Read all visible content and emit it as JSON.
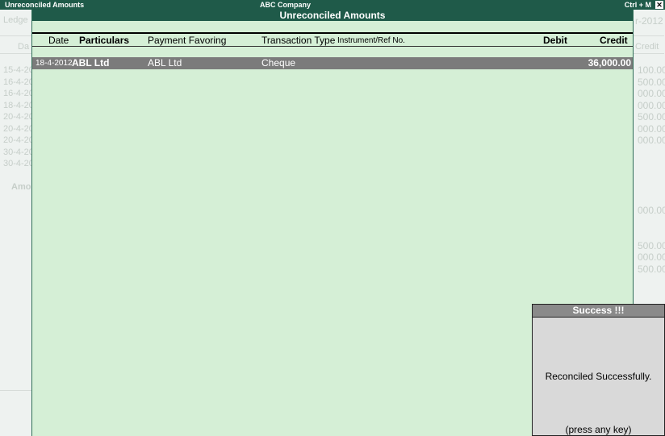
{
  "window": {
    "title": "Unreconciled Amounts",
    "company": "ABC Company",
    "shortcut": "Ctrl + M",
    "close_glyph": "✕"
  },
  "background": {
    "ledger_label": "Ledge",
    "dr_label": "Da",
    "amount_label": "Amo",
    "credit_label": "Credit",
    "year_fragment": "r-2012",
    "date_fragments": [
      "15-4-20",
      "16-4-20",
      "16-4-20",
      "18-4-20",
      "20-4-20",
      "20-4-20",
      "20-4-20",
      "30-4-20",
      "30-4-20"
    ],
    "value_fragments": [
      "100.00",
      "500.00",
      "000.00",
      "000.00",
      "500.00",
      "000.00",
      "",
      "000.00"
    ],
    "value_fragments_lower": [
      "000.00",
      "",
      "",
      "500.00",
      "000.00",
      "500.00"
    ]
  },
  "panel": {
    "title": "Unreconciled Amounts",
    "columns": {
      "date": "Date",
      "particulars": "Particulars",
      "payment_favoring": "Payment Favoring",
      "transaction_type": "Transaction Type",
      "instrument": "Instrument/Ref No.",
      "debit": "Debit",
      "credit": "Credit"
    },
    "row": {
      "date": "18-4-2012",
      "particulars": "ABL Ltd",
      "payment_favoring": "ABL Ltd",
      "transaction_type": "Cheque",
      "instrument": "",
      "debit": "",
      "credit": "36,000.00"
    }
  },
  "dialog": {
    "title": "Success !!!",
    "message": "Reconciled Successfully.",
    "hint": "(press any key)"
  }
}
